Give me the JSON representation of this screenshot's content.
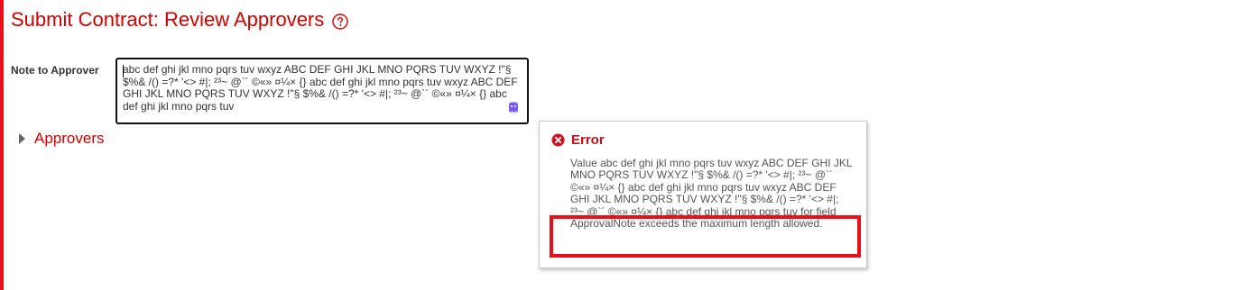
{
  "page": {
    "title": "Submit Contract: Review Approvers",
    "help_icon": "question-circle-icon"
  },
  "form": {
    "note_label": "Note to Approver",
    "note_value": "abc def ghi jkl mno pqrs tuv wxyz ABC DEF GHI JKL MNO PQRS TUV WXYZ !\"§ $%& /() =?* '<> #|; ²³~ @`´ ©«» ¤¼× {} abc def ghi jkl mno pqrs tuv wxyz ABC DEF GHI JKL MNO PQRS TUV WXYZ !\"§ $%& /() =?* '<> #|; ²³~ @`´ ©«» ¤¼× {} abc def ghi jkl mno pqrs tuv"
  },
  "sections": {
    "approvers_label": "Approvers"
  },
  "error": {
    "title": "Error",
    "message": "Value abc def ghi jkl mno pqrs tuv wxyz ABC DEF GHI JKL MNO PQRS TUV WXYZ !\"§ $%& /() =?* '<> #|; ²³~ @`´ ©«» ¤¼× {} abc def ghi jkl mno pqrs tuv wxyz ABC DEF GHI JKL MNO PQRS TUV WXYZ !\"§ $%& /() =?* '<> #|; ²³~ @`´ ©«» ¤¼× {} abc def ghi jkl mno pqrs tuv for field ApprovalNote exceeds the maximum length allowed."
  },
  "colors": {
    "accent_red": "#cc0000",
    "highlight_red": "#e8101a"
  }
}
